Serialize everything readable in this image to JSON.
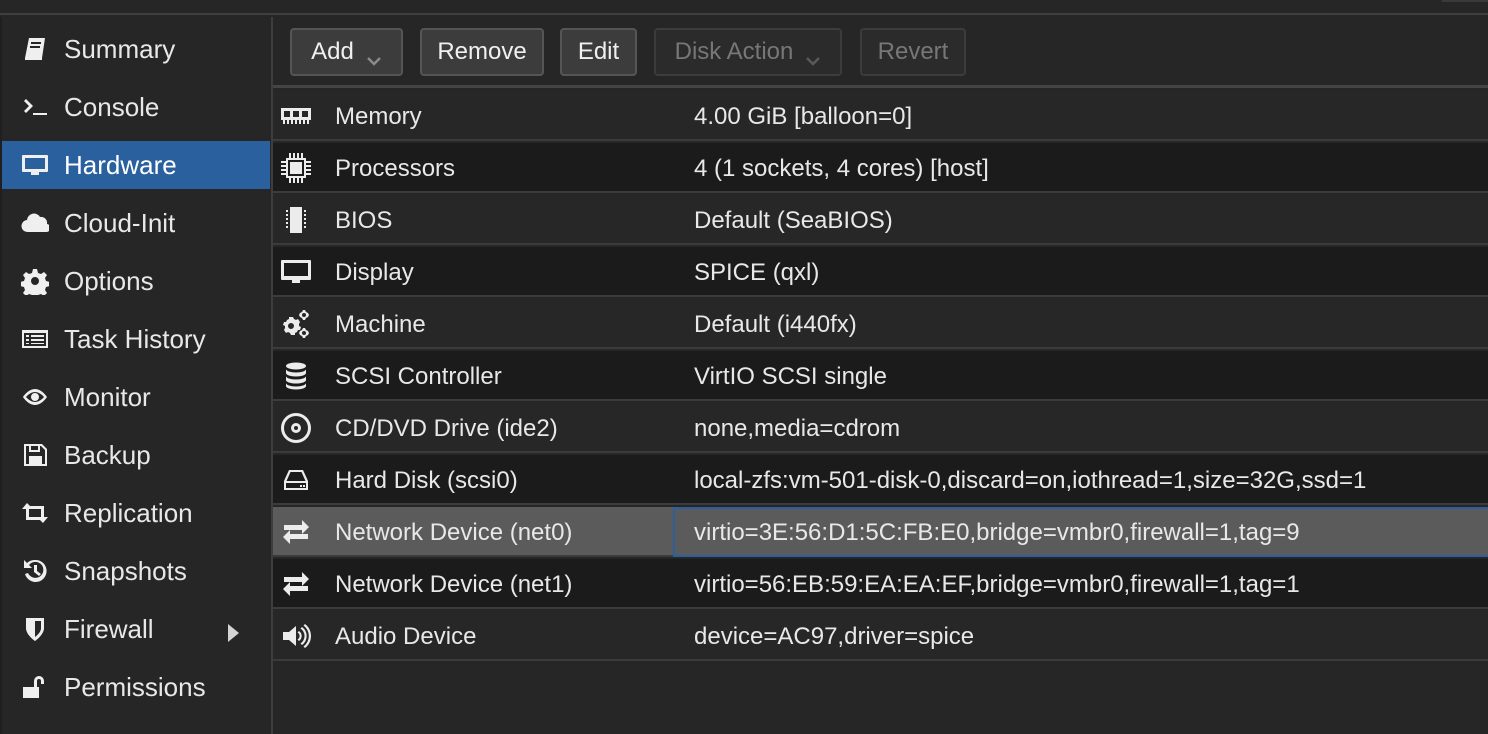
{
  "sidebar": {
    "items": [
      {
        "label": "Summary",
        "icon": "book-icon",
        "active": false
      },
      {
        "label": "Console",
        "icon": "terminal-icon",
        "active": false
      },
      {
        "label": "Hardware",
        "icon": "desktop-icon",
        "active": true
      },
      {
        "label": "Cloud-Init",
        "icon": "cloud-icon",
        "active": false
      },
      {
        "label": "Options",
        "icon": "gear-icon",
        "active": false
      },
      {
        "label": "Task History",
        "icon": "list-icon",
        "active": false
      },
      {
        "label": "Monitor",
        "icon": "eye-icon",
        "active": false
      },
      {
        "label": "Backup",
        "icon": "floppy-icon",
        "active": false
      },
      {
        "label": "Replication",
        "icon": "retweet-icon",
        "active": false
      },
      {
        "label": "Snapshots",
        "icon": "history-icon",
        "active": false
      },
      {
        "label": "Firewall",
        "icon": "shield-icon",
        "active": false,
        "has_submenu": true
      },
      {
        "label": "Permissions",
        "icon": "unlock-icon",
        "active": false
      }
    ]
  },
  "toolbar": {
    "add_label": "Add",
    "remove_label": "Remove",
    "edit_label": "Edit",
    "disk_action_label": "Disk Action",
    "revert_label": "Revert"
  },
  "hardware": {
    "rows": [
      {
        "name": "Memory",
        "value": "4.00 GiB [balloon=0]",
        "icon": "memory-icon"
      },
      {
        "name": "Processors",
        "value": "4 (1 sockets, 4 cores) [host]",
        "icon": "cpu-icon"
      },
      {
        "name": "BIOS",
        "value": "Default (SeaBIOS)",
        "icon": "microchip-icon"
      },
      {
        "name": "Display",
        "value": "SPICE (qxl)",
        "icon": "desktop-icon"
      },
      {
        "name": "Machine",
        "value": "Default (i440fx)",
        "icon": "cogs-icon"
      },
      {
        "name": "SCSI Controller",
        "value": "VirtIO SCSI single",
        "icon": "database-icon"
      },
      {
        "name": "CD/DVD Drive (ide2)",
        "value": "none,media=cdrom",
        "icon": "cdrom-icon"
      },
      {
        "name": "Hard Disk (scsi0)",
        "value": "local-zfs:vm-501-disk-0,discard=on,iothread=1,size=32G,ssd=1",
        "icon": "hdd-icon"
      },
      {
        "name": "Network Device (net0)",
        "value": "virtio=3E:56:D1:5C:FB:E0,bridge=vmbr0,firewall=1,tag=9",
        "icon": "exchange-icon",
        "selected": true
      },
      {
        "name": "Network Device (net1)",
        "value": "virtio=56:EB:59:EA:EA:EF,bridge=vmbr0,firewall=1,tag=1",
        "icon": "exchange-icon"
      },
      {
        "name": "Audio Device",
        "value": "device=AC97,driver=spice",
        "icon": "volume-icon"
      }
    ]
  },
  "colors": {
    "accent": "#2a609e",
    "background": "#262626",
    "row_alt": "#1b1b1b",
    "selected_row": "#5b5b5b"
  }
}
